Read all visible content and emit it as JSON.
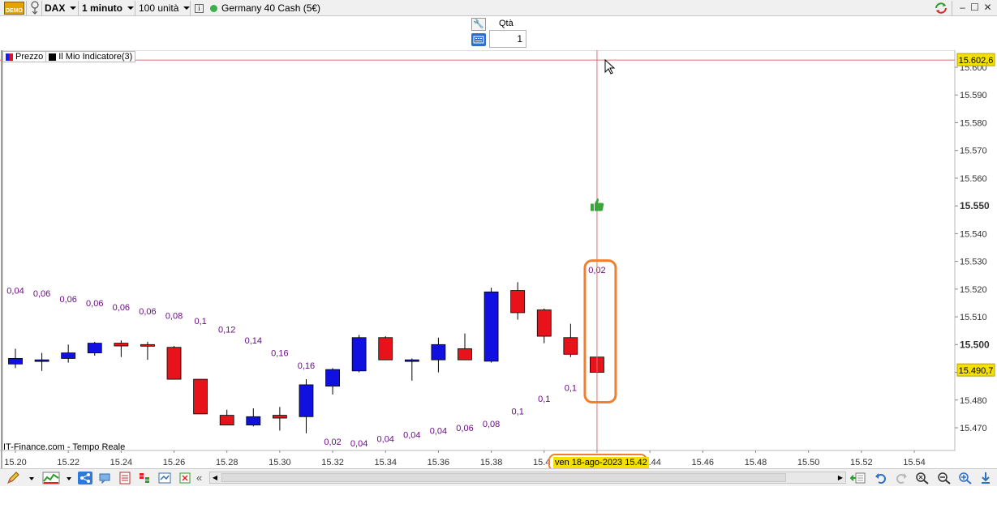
{
  "toolbar": {
    "demo_label": "DEMO",
    "instrument": "DAX",
    "timeframe": "1 minuto",
    "units": "100 unità",
    "info_label": "i",
    "market_name": "Germany 40 Cash (5€)"
  },
  "qty": {
    "label": "Qtà",
    "value": "1"
  },
  "legend": {
    "price_label": "Prezzo",
    "indicator_label": "Il Mio Indicatore(3)",
    "price_color": "#1a1aff",
    "indicator_color": "#000000"
  },
  "source_label": "IT-Finance.com - Tempo Reale",
  "crosshair": {
    "date_label": "ven 18-ago-2023 15.42",
    "price_label": "15.602,6",
    "last_price_label": "15.490,7",
    "highlight_color": "#f5e100",
    "annotation_color": "#f08030"
  },
  "colors": {
    "up": "#1010e0",
    "down": "#e8121a",
    "indicator_text": "#6a0d83",
    "crosshair": "#e07070",
    "thumbs_up": "#3aa53a"
  },
  "chart_data": {
    "type": "candlestick",
    "ylim": [
      15460,
      15608
    ],
    "y_ticks": [
      "15.600",
      "15.590",
      "15.580",
      "15.570",
      "15.560",
      "15.550",
      "15.540",
      "15.530",
      "15.520",
      "15.510",
      "15.500",
      "15.490",
      "15.480",
      "15.470"
    ],
    "y_tick_values": [
      15600,
      15590,
      15580,
      15570,
      15560,
      15550,
      15540,
      15530,
      15520,
      15510,
      15500,
      15490,
      15480,
      15470
    ],
    "y_bold_ticks": [
      "15.550",
      "15.500"
    ],
    "x_tick_labels": [
      "15.20",
      "15.22",
      "15.24",
      "15.26",
      "15.28",
      "15.30",
      "15.32",
      "15.34",
      "15.36",
      "15.38",
      "15.40",
      "15.42",
      "15.44",
      "15.46",
      "15.48",
      "15.50",
      "15.52",
      "15.54"
    ],
    "x_tick_minutes": [
      20,
      22,
      24,
      26,
      28,
      30,
      32,
      34,
      36,
      38,
      40,
      42,
      44,
      46,
      48,
      50,
      52,
      54
    ],
    "candles": [
      {
        "t": 20,
        "o": 15493.0,
        "h": 15498.5,
        "l": 15491.5,
        "c": 15495.0
      },
      {
        "t": 21,
        "o": 15494.0,
        "h": 15497.0,
        "l": 15490.5,
        "c": 15494.5
      },
      {
        "t": 22,
        "o": 15495.0,
        "h": 15500.0,
        "l": 15493.5,
        "c": 15497.0
      },
      {
        "t": 23,
        "o": 15497.0,
        "h": 15501.0,
        "l": 15496.0,
        "c": 15500.5
      },
      {
        "t": 24,
        "o": 15500.5,
        "h": 15501.5,
        "l": 15495.5,
        "c": 15499.5
      },
      {
        "t": 25,
        "o": 15500.0,
        "h": 15501.0,
        "l": 15494.5,
        "c": 15499.5
      },
      {
        "t": 26,
        "o": 15499.0,
        "h": 15499.5,
        "l": 15487.5,
        "c": 15487.5
      },
      {
        "t": 27,
        "o": 15487.5,
        "h": 15487.5,
        "l": 15475.0,
        "c": 15475.0
      },
      {
        "t": 28,
        "o": 15474.5,
        "h": 15476.5,
        "l": 15471.0,
        "c": 15471.0
      },
      {
        "t": 29,
        "o": 15471.0,
        "h": 15477.0,
        "l": 15470.5,
        "c": 15474.0
      },
      {
        "t": 30,
        "o": 15474.5,
        "h": 15477.5,
        "l": 15469.0,
        "c": 15473.5
      },
      {
        "t": 31,
        "o": 15474.0,
        "h": 15487.5,
        "l": 15468.0,
        "c": 15485.5
      },
      {
        "t": 32,
        "o": 15485.0,
        "h": 15491.5,
        "l": 15482.0,
        "c": 15491.0
      },
      {
        "t": 33,
        "o": 15490.5,
        "h": 15503.5,
        "l": 15490.0,
        "c": 15502.5
      },
      {
        "t": 34,
        "o": 15502.5,
        "h": 15503.0,
        "l": 15494.5,
        "c": 15494.5
      },
      {
        "t": 35,
        "o": 15494.0,
        "h": 15495.0,
        "l": 15487.0,
        "c": 15494.5
      },
      {
        "t": 36,
        "o": 15494.5,
        "h": 15502.5,
        "l": 15490.0,
        "c": 15500.0
      },
      {
        "t": 37,
        "o": 15498.5,
        "h": 15504.0,
        "l": 15494.5,
        "c": 15494.5
      },
      {
        "t": 38,
        "o": 15494.0,
        "h": 15520.5,
        "l": 15493.5,
        "c": 15519.0
      },
      {
        "t": 39,
        "o": 15519.5,
        "h": 15522.5,
        "l": 15509.0,
        "c": 15511.5
      },
      {
        "t": 40,
        "o": 15512.5,
        "h": 15513.0,
        "l": 15500.5,
        "c": 15503.0
      },
      {
        "t": 41,
        "o": 15502.5,
        "h": 15507.5,
        "l": 15495.5,
        "c": 15496.5
      },
      {
        "t": 42,
        "o": 15495.5,
        "h": 15495.5,
        "l": 15489.5,
        "c": 15490.0
      }
    ],
    "indicator_labels": [
      {
        "t": 20,
        "value": "0,04",
        "y": 15519.5
      },
      {
        "t": 21,
        "value": "0,06",
        "y": 15518.5
      },
      {
        "t": 22,
        "value": "0,06",
        "y": 15516.5
      },
      {
        "t": 23,
        "value": "0,06",
        "y": 15515.0
      },
      {
        "t": 24,
        "value": "0,06",
        "y": 15513.5
      },
      {
        "t": 25,
        "value": "0,06",
        "y": 15512.0
      },
      {
        "t": 26,
        "value": "0,08",
        "y": 15510.5
      },
      {
        "t": 27,
        "value": "0,1",
        "y": 15508.5
      },
      {
        "t": 28,
        "value": "0,12",
        "y": 15505.5
      },
      {
        "t": 29,
        "value": "0,14",
        "y": 15501.5
      },
      {
        "t": 30,
        "value": "0,16",
        "y": 15497.0
      },
      {
        "t": 31,
        "value": "0,16",
        "y": 15492.5
      },
      {
        "t": 32,
        "value": "0,02",
        "y": 15465.0
      },
      {
        "t": 33,
        "value": "0,04",
        "y": 15464.5
      },
      {
        "t": 34,
        "value": "0,04",
        "y": 15466.0
      },
      {
        "t": 35,
        "value": "0,04",
        "y": 15467.5
      },
      {
        "t": 36,
        "value": "0,04",
        "y": 15469.0
      },
      {
        "t": 37,
        "value": "0,06",
        "y": 15470.0
      },
      {
        "t": 38,
        "value": "0,08",
        "y": 15471.5
      },
      {
        "t": 39,
        "value": "0,1",
        "y": 15476.0
      },
      {
        "t": 40,
        "value": "0,1",
        "y": 15480.5
      },
      {
        "t": 41,
        "value": "0,1",
        "y": 15484.5
      },
      {
        "t": 42,
        "value": "0,02",
        "y": 15527.0
      }
    ],
    "thumbs_up_at": {
      "t": 42,
      "y": 15550.5
    },
    "crosshair_t": 42,
    "crosshair_y": 15602.6,
    "last_price": 15490.7
  }
}
